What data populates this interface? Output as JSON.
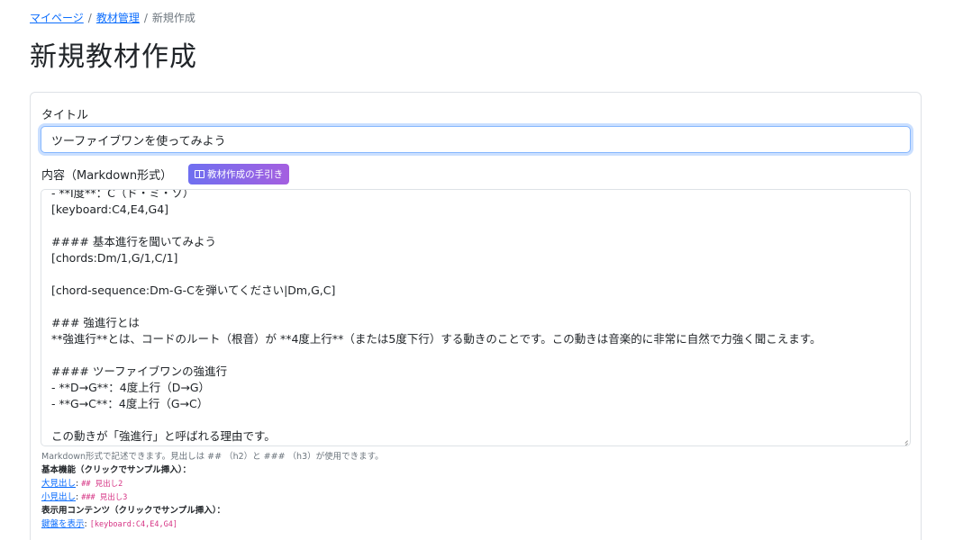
{
  "breadcrumb": {
    "items": [
      "マイページ",
      "教材管理",
      "新規作成"
    ],
    "separator": "/"
  },
  "page_title": "新規教材作成",
  "form": {
    "title_label": "タイトル",
    "title_value": "ツーファイブワンを使ってみよう",
    "content_label": "内容（Markdown形式）",
    "guide_button": "教材作成の手引き",
    "guide_icon": "book-icon",
    "content_lines": [
      "- **Ⅰ度**：C（ド・ミ・ソ）",
      "[keyboard:C4,E4,G4]",
      "",
      "#### 基本進行を聞いてみよう",
      "[chords:Dm/1,G/1,C/1]",
      "",
      "[chord-sequence:Dm-G-Cを弾いてください|Dm,G,C]",
      "",
      "### 強進行とは",
      "**強進行**とは、コードのルート（根音）が **4度上行**（または5度下行）する動きのことです。この動きは音楽的に非常に自然で力強く聞こえます。",
      "",
      "#### ツーファイブワンの強進行",
      "- **D→G**：4度上行（D→G）",
      "- **G→C**：4度上行（G→C）",
      "",
      "この動きが「強進行」と呼ばれる理由です。"
    ]
  },
  "help": {
    "intro": "Markdown形式で記述できます。見出しは ## （h2）と ### （h3）が使用できます。",
    "basic_heading": "基本機能（クリックでサンプル挿入）：",
    "basic_items": [
      {
        "link": "大見出し",
        "sep": ": ",
        "code": "## 見出し2"
      },
      {
        "link": "小見出し",
        "sep": ": ",
        "code": "### 見出し3"
      }
    ],
    "display_heading": "表示用コンテンツ（クリックでサンプル挿入）：",
    "display_items": [
      {
        "link": "鍵盤を表示",
        "sep": ": ",
        "code": "[keyboard:C4,E4,G4]"
      }
    ]
  },
  "colors": {
    "link": "#0d6efd",
    "code": "#d63384",
    "guide_gradient_start": "#6f6ff0",
    "guide_gradient_end": "#a45fe0",
    "focus_border": "#86b7fe"
  }
}
